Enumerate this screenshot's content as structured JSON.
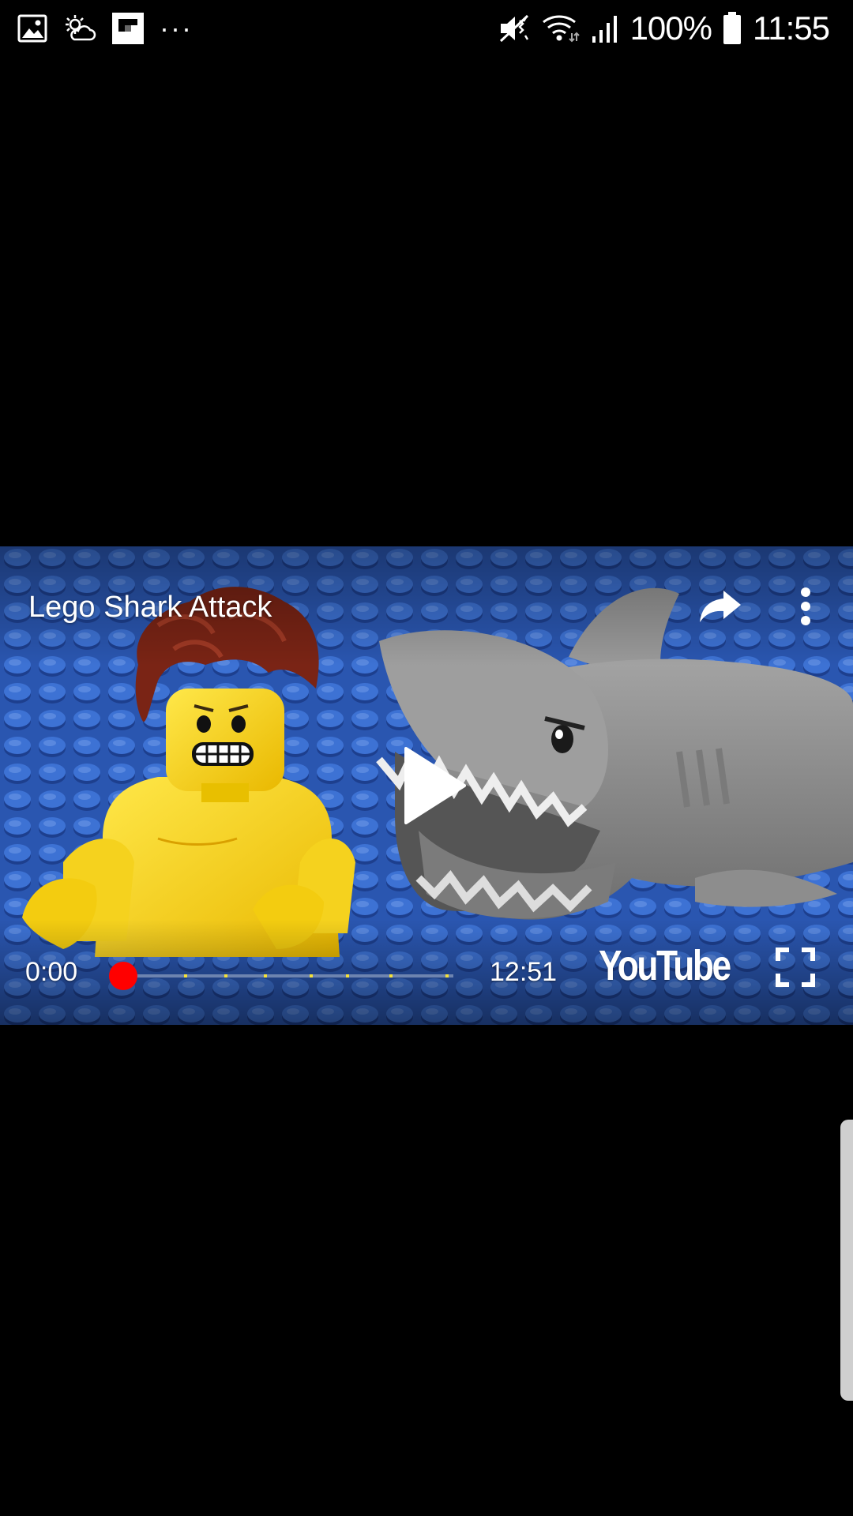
{
  "status_bar": {
    "left_icons": [
      "gallery-icon",
      "weather-icon",
      "flipboard-icon",
      "more-notifications-icon"
    ],
    "more_notifications_glyph": "···",
    "right_icons": [
      "mute-vibrate-icon",
      "wifi-icon",
      "signal-icon"
    ],
    "battery_percent": "100%",
    "battery_level": 1.0,
    "time": "11:55"
  },
  "player": {
    "title": "Lego Shark Attack",
    "share_icon": "share-icon",
    "more_icon": "more-vert-icon",
    "play_icon": "play-icon",
    "current_time": "0:00",
    "total_time": "12:51",
    "progress": 0.0,
    "chapter_markers": [
      0.19,
      0.31,
      0.43,
      0.57,
      0.68,
      0.81,
      0.98
    ],
    "logo_text": "YouTube",
    "fullscreen_icon": "fullscreen-icon",
    "colors": {
      "played": "#ff0000",
      "scrubber": "#ff0000",
      "marker": "#f5e13a"
    }
  }
}
